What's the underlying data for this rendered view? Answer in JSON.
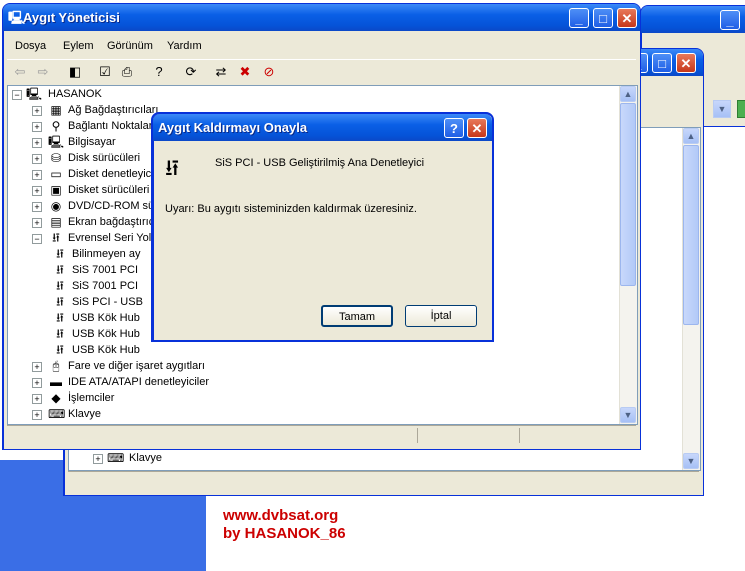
{
  "main_window": {
    "title": "Aygıt Yöneticisi",
    "menus": [
      "Dosya",
      "Eylem",
      "Görünüm",
      "Yardım"
    ],
    "tree": {
      "root": "HASANOK",
      "items": [
        {
          "label": "Ağ Bağdaştırıcıları",
          "icon": "network-adapter-icon",
          "expanded": false
        },
        {
          "label": "Bağlantı Noktaları",
          "icon": "ports-icon",
          "expanded": false
        },
        {
          "label": "Bilgisayar",
          "icon": "computer-icon",
          "expanded": false
        },
        {
          "label": "Disk sürücüleri",
          "icon": "disk-drive-icon",
          "expanded": false
        },
        {
          "label": "Disket denetleyici",
          "icon": "floppy-controller-icon",
          "expanded": false
        },
        {
          "label": "Disket sürücüleri",
          "icon": "floppy-drive-icon",
          "expanded": false
        },
        {
          "label": "DVD/CD-ROM sürü",
          "icon": "cdrom-icon",
          "expanded": false
        },
        {
          "label": "Ekran bağdaştırıcı",
          "icon": "display-adapter-icon",
          "expanded": false
        },
        {
          "label": "Evrensel Seri Yol D",
          "icon": "usb-icon",
          "expanded": true
        },
        {
          "label": "Bilinmeyen ay",
          "icon": "usb-icon",
          "child": true
        },
        {
          "label": "SiS 7001 PCI",
          "icon": "usb-icon",
          "child": true
        },
        {
          "label": "SiS 7001 PCI",
          "icon": "usb-icon",
          "child": true
        },
        {
          "label": "SiS PCI - USB",
          "icon": "usb-icon",
          "child": true
        },
        {
          "label": "USB Kök Hub",
          "icon": "usb-icon",
          "child": true
        },
        {
          "label": "USB Kök Hub",
          "icon": "usb-icon",
          "child": true
        },
        {
          "label": "USB Kök Hub",
          "icon": "usb-icon",
          "child": true
        },
        {
          "label": "Fare ve diğer işaret aygıtları",
          "icon": "mouse-icon",
          "expanded": false
        },
        {
          "label": "IDE ATA/ATAPI denetleyiciler",
          "icon": "ide-controller-icon",
          "expanded": false
        },
        {
          "label": "İşlemciler",
          "icon": "processor-icon",
          "expanded": false
        },
        {
          "label": "Klavye",
          "icon": "keyboard-icon",
          "expanded": false
        }
      ]
    }
  },
  "back_window": {
    "tree_item": "Klavye"
  },
  "dialog": {
    "title": "Aygıt Kaldırmayı Onayla",
    "device_name": "SiS PCI - USB Geliştirilmiş Ana Denetleyici",
    "warning": "Uyarı: Bu aygıtı sisteminizden kaldırmak üzeresiniz.",
    "ok_label": "Tamam",
    "cancel_label": "İptal"
  },
  "watermark": {
    "line1": "www.dvbsat.org",
    "line2": "by HASANOK_86",
    "color": "#cc0000"
  }
}
